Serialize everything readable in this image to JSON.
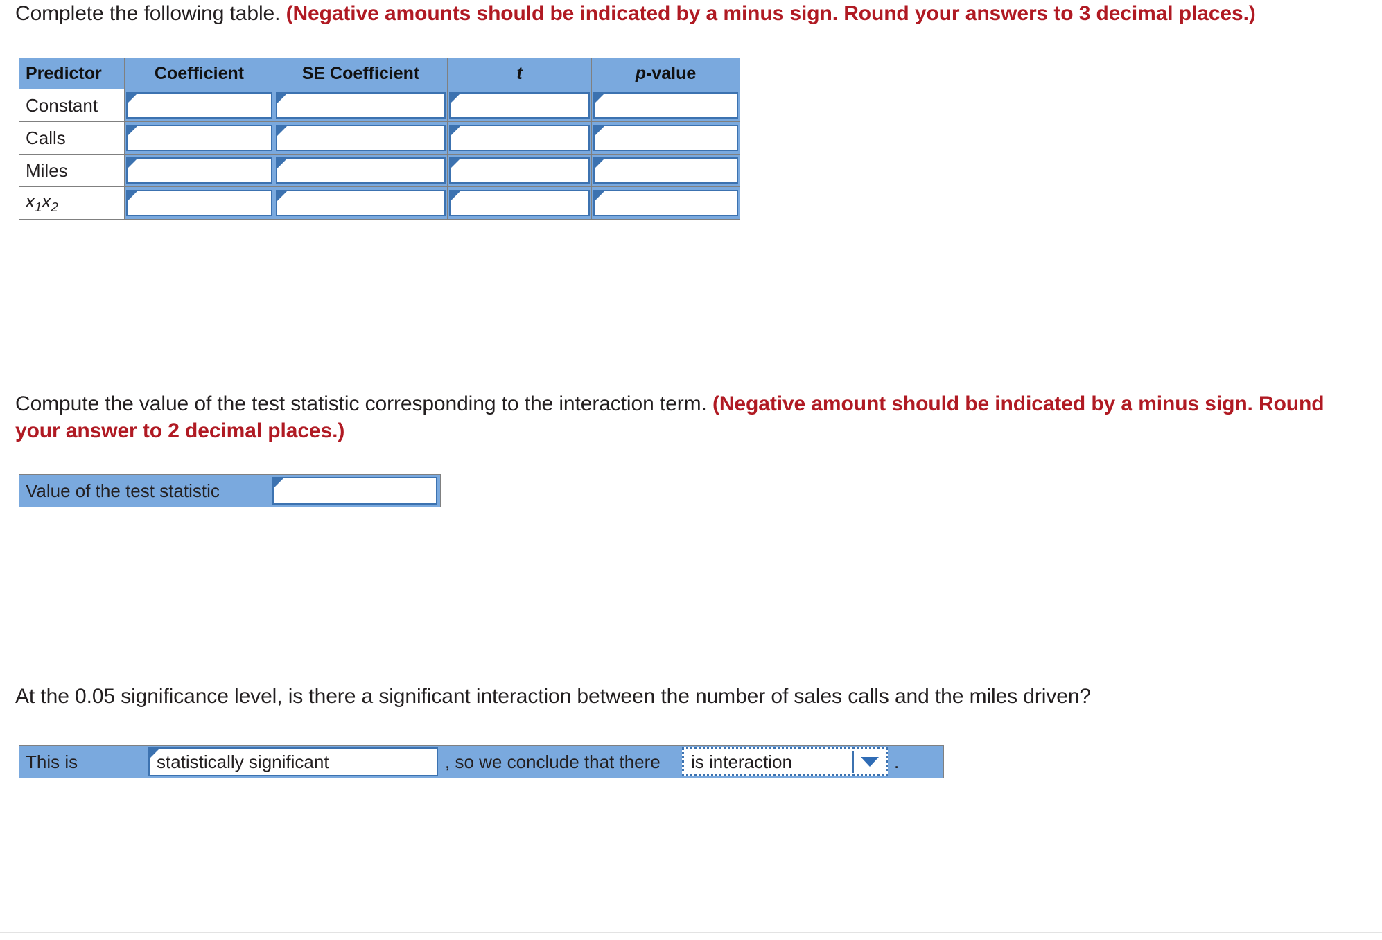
{
  "questions": {
    "q1": {
      "text": "Complete the following table. ",
      "note": "(Negative amounts should be indicated by a minus sign. Round your answers to 3 decimal places.)"
    },
    "q2": {
      "text": "Compute the value of the test statistic corresponding to the interaction term. ",
      "note": "(Negative amount should be indicated by a minus sign. Round your answer to 2 decimal places.)"
    },
    "q3": {
      "text": "At the 0.05 significance level, is there a significant interaction between the number of sales calls and the miles driven?"
    }
  },
  "predictor_table": {
    "headers": [
      "Predictor",
      "Coefficient",
      "SE Coefficient",
      "t",
      "p-value"
    ],
    "rows": [
      {
        "label": "Constant",
        "label_html": "Constant",
        "values": [
          "",
          "",
          "",
          ""
        ]
      },
      {
        "label": "Calls",
        "label_html": "Calls",
        "values": [
          "",
          "",
          "",
          ""
        ]
      },
      {
        "label": "Miles",
        "label_html": "Miles",
        "values": [
          "",
          "",
          "",
          ""
        ]
      },
      {
        "label": "x1x2",
        "label_html": "x1x2",
        "values": [
          "",
          "",
          "",
          ""
        ]
      }
    ]
  },
  "test_statistic": {
    "label": "Value of the test statistic",
    "value": ""
  },
  "conclusion": {
    "lead_text": "This is",
    "significance_value": "statistically significant",
    "middle_text": ", so we conclude that there",
    "interaction_value": "is interaction",
    "trailing_text": "."
  },
  "colors": {
    "header_blue": "#7aa9de",
    "field_border_blue": "#3c72b0",
    "note_red": "#b01a23",
    "grid_gray": "#808080",
    "body_text": "#231f20"
  },
  "icons": {
    "dropdown": "chevron-down-icon",
    "field_marker": "input-corner-marker-icon"
  }
}
